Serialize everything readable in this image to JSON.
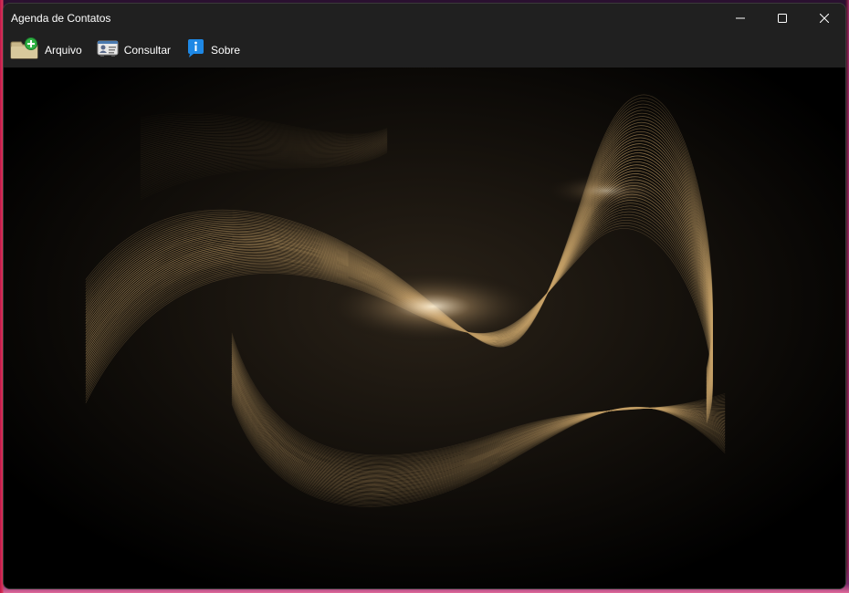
{
  "window": {
    "title": "Agenda de Contatos"
  },
  "controls": {
    "minimize_icon": "minimize-icon",
    "maximize_icon": "maximize-icon",
    "close_icon": "close-icon"
  },
  "menu": {
    "items": [
      {
        "label": "Arquivo",
        "icon": "folder-add-icon"
      },
      {
        "label": "Consultar",
        "icon": "contact-card-icon"
      },
      {
        "label": "Sobre",
        "icon": "info-icon"
      }
    ]
  },
  "colors": {
    "titlebar": "#202020",
    "content_background": "#000000",
    "wave_gold": "#c9a46a",
    "info_blue": "#1e88e5",
    "add_green": "#2fb344"
  }
}
